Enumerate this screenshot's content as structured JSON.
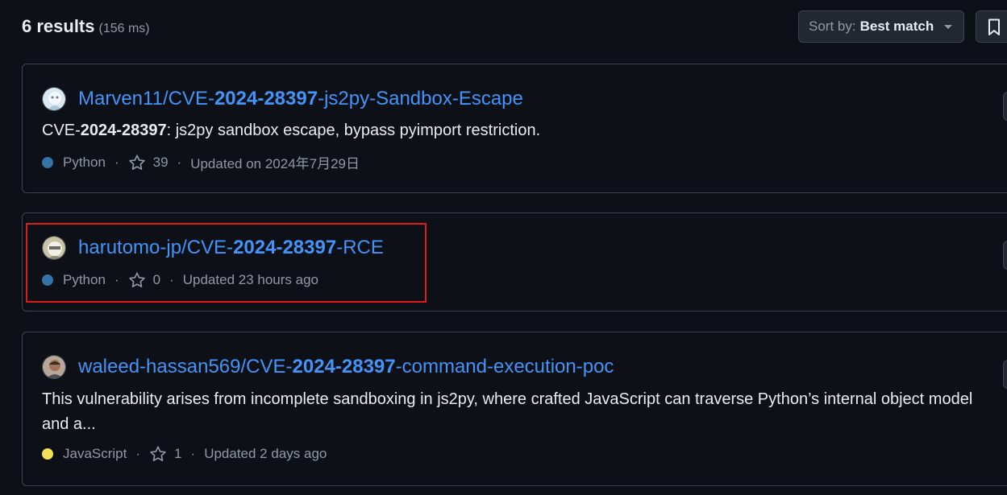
{
  "header": {
    "results_count": "6 results",
    "results_time": "(156 ms)",
    "sort_prefix": "Sort by:",
    "sort_value": "Best match"
  },
  "results": [
    {
      "owner": "Marven11/",
      "name_prefix": "CVE-",
      "name_match": "2024-28397",
      "name_suffix": "-js2py-Sandbox-Escape",
      "desc_prefix": "CVE-",
      "desc_match": "2024-28397",
      "desc_suffix": ": js2py sandbox escape, bypass pyimport restriction.",
      "language": "Python",
      "language_color": "#3572A5",
      "stars": "39",
      "updated": "Updated on 2024年7月29日"
    },
    {
      "owner": "harutomo-jp/",
      "name_prefix": "CVE-",
      "name_match": "2024-28397",
      "name_suffix": "-RCE",
      "language": "Python",
      "language_color": "#3572A5",
      "stars": "0",
      "updated": "Updated 23 hours ago"
    },
    {
      "owner": "waleed-hassan569/",
      "name_prefix": "CVE-",
      "name_match": "2024-28397",
      "name_suffix": "-command-execution-poc",
      "description": "This vulnerability arises from incomplete sandboxing in js2py, where crafted JavaScript can traverse Python’s internal object model and a...",
      "language": "JavaScript",
      "language_color": "#f1e05a",
      "stars": "1",
      "updated": "Updated 2 days ago"
    }
  ],
  "separator": "·",
  "colors": {
    "background": "#0d1117",
    "link": "#4493f8",
    "muted": "#9198a1",
    "border": "#3d444d",
    "highlight": "#e01b1b"
  }
}
